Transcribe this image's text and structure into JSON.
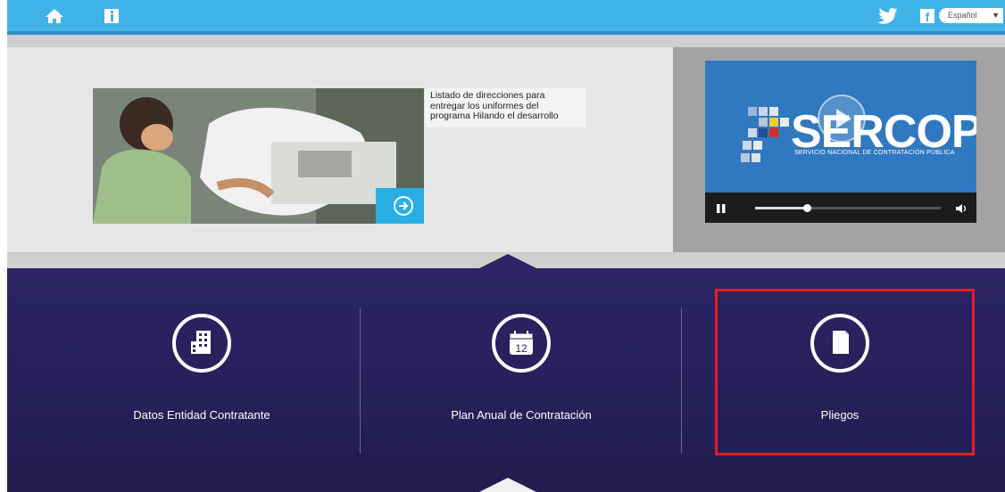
{
  "topbar": {
    "home_icon": "home-icon",
    "info_icon": "info-icon",
    "twitter_icon": "twitter-icon",
    "facebook_icon": "facebook-icon",
    "facebook_glyph": "f",
    "language": "Español",
    "bg_color": "#3fb3e8"
  },
  "news": {
    "caption": "Listado de direcciones para entregar los uniformes del programa Hilando el desarrollo"
  },
  "video": {
    "title": "SERCOP",
    "subtitle": "SERVICIO NACIONAL DE CONTRATACIÓN PÚBLICA",
    "progress": 0.28
  },
  "nav": {
    "items": [
      {
        "label": "Datos Entidad Contratante",
        "icon": "building-icon"
      },
      {
        "label": "Plan Anual de Contratación",
        "icon": "calendar-icon",
        "icon_text": "12"
      },
      {
        "label": "Pliegos",
        "icon": "document-icon"
      }
    ],
    "bg_color": "#2c2464",
    "highlight_color": "#e01e25"
  }
}
